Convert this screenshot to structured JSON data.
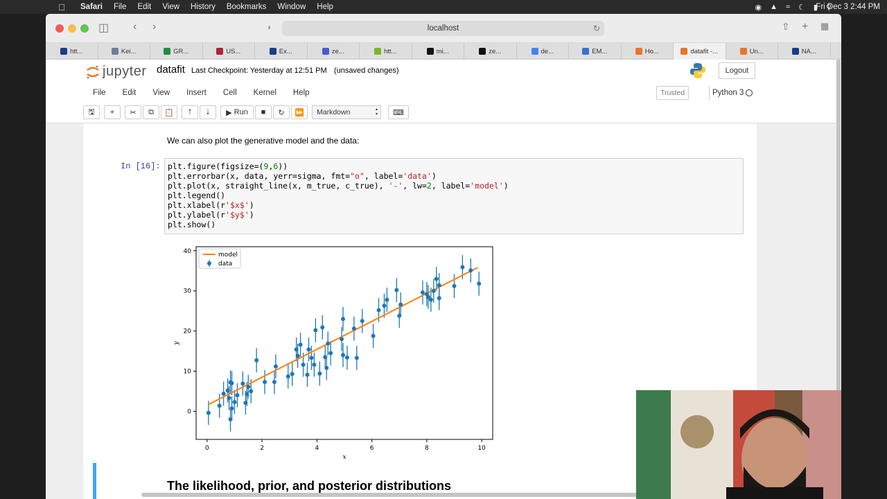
{
  "macos_menubar": {
    "app": "Safari",
    "items": [
      "File",
      "Edit",
      "View",
      "History",
      "Bookmarks",
      "Window",
      "Help"
    ],
    "clock": "Fri Dec 3  2:44 PM"
  },
  "browser": {
    "url": "localhost",
    "tabs": [
      {
        "label": "htt...",
        "color": "#1a3d8a"
      },
      {
        "label": "Kei...",
        "color": "#6b7f99"
      },
      {
        "label": "GR...",
        "color": "#1e8e3e"
      },
      {
        "label": "US...",
        "color": "#b22234"
      },
      {
        "label": "Ex...",
        "color": "#1a3d8a"
      },
      {
        "label": "ze...",
        "color": "#4a5bd1"
      },
      {
        "label": "htt...",
        "color": "#7ab82a"
      },
      {
        "label": "mi...",
        "color": "#111111"
      },
      {
        "label": "ze...",
        "color": "#111111"
      },
      {
        "label": "de...",
        "color": "#4285f4"
      },
      {
        "label": "EM...",
        "color": "#3b6fd1"
      },
      {
        "label": "Ho...",
        "color": "#e8742c"
      },
      {
        "label": "datafit -...",
        "color": "#e8742c"
      },
      {
        "label": "Un...",
        "color": "#e8742c"
      },
      {
        "label": "NA...",
        "color": "#1a3d8a"
      }
    ],
    "active_tab_index": 12
  },
  "jupyter": {
    "logo_text": "jupyter",
    "notebook_name": "datafit",
    "checkpoint": "Last Checkpoint: Yesterday at 12:51 PM",
    "unsaved": "(unsaved changes)",
    "logout": "Logout",
    "menus": [
      "File",
      "Edit",
      "View",
      "Insert",
      "Cell",
      "Kernel",
      "Help"
    ],
    "trusted": "Trusted",
    "kernel": "Python 3",
    "run_label": "Run",
    "cell_type": "Markdown",
    "markdown_text": "We can also plot the generative model and the data:",
    "prompt": "In [16]:",
    "heading": "The likelihood, prior, and posterior distributions"
  },
  "chart_data": {
    "type": "scatter",
    "title": "",
    "xlabel": "x",
    "ylabel": "y",
    "xlim": [
      -0.4,
      10.4
    ],
    "ylim": [
      -7,
      41
    ],
    "xticks": [
      0,
      2,
      4,
      6,
      8,
      10
    ],
    "yticks": [
      0,
      10,
      20,
      30,
      40
    ],
    "legend_position": "top-left",
    "series": [
      {
        "name": "model",
        "kind": "line",
        "color": "#ff7f0e",
        "x": [
          0.05,
          9.85
        ],
        "y": [
          1.7,
          35.8
        ]
      },
      {
        "name": "data",
        "kind": "errorbar",
        "color": "#1f77b4",
        "yerr": 3,
        "points": [
          [
            0.05,
            -0.4
          ],
          [
            0.45,
            1.4
          ],
          [
            0.6,
            4.4
          ],
          [
            0.75,
            5.2
          ],
          [
            0.8,
            3.3
          ],
          [
            0.85,
            7.2
          ],
          [
            0.85,
            -2.0
          ],
          [
            0.9,
            0.7
          ],
          [
            0.9,
            7.0
          ],
          [
            1.0,
            2.3
          ],
          [
            1.1,
            4.0
          ],
          [
            1.3,
            6.9
          ],
          [
            1.4,
            2.1
          ],
          [
            1.45,
            4.3
          ],
          [
            1.5,
            6.1
          ],
          [
            1.6,
            5.0
          ],
          [
            1.8,
            12.7
          ],
          [
            2.1,
            7.3
          ],
          [
            2.45,
            7.3
          ],
          [
            2.5,
            11.2
          ],
          [
            2.95,
            8.7
          ],
          [
            3.1,
            9.3
          ],
          [
            3.25,
            15.4
          ],
          [
            3.3,
            13.8
          ],
          [
            3.4,
            16.6
          ],
          [
            3.5,
            11.6
          ],
          [
            3.65,
            9.1
          ],
          [
            3.7,
            15.4
          ],
          [
            3.8,
            13.3
          ],
          [
            3.9,
            11.6
          ],
          [
            3.95,
            20.2
          ],
          [
            4.1,
            9.4
          ],
          [
            4.2,
            20.9
          ],
          [
            4.3,
            13.5
          ],
          [
            4.35,
            10.8
          ],
          [
            4.4,
            16.9
          ],
          [
            4.5,
            14.5
          ],
          [
            4.9,
            18.0
          ],
          [
            4.95,
            23.0
          ],
          [
            4.95,
            14.0
          ],
          [
            5.1,
            13.4
          ],
          [
            5.35,
            20.6
          ],
          [
            5.45,
            13.3
          ],
          [
            5.65,
            22.5
          ],
          [
            6.05,
            18.8
          ],
          [
            6.25,
            25.2
          ],
          [
            6.45,
            26.3
          ],
          [
            6.55,
            27.8
          ],
          [
            6.9,
            30.2
          ],
          [
            7.0,
            23.8
          ],
          [
            7.05,
            26.6
          ],
          [
            7.85,
            29.6
          ],
          [
            8.0,
            29.2
          ],
          [
            8.05,
            28.5
          ],
          [
            8.15,
            27.8
          ],
          [
            8.25,
            30.0
          ],
          [
            8.35,
            33.0
          ],
          [
            8.45,
            31.4
          ],
          [
            8.45,
            28.2
          ],
          [
            9.0,
            31.2
          ],
          [
            9.3,
            35.9
          ],
          [
            9.6,
            35.1
          ],
          [
            9.9,
            31.8
          ]
        ]
      }
    ]
  },
  "code_lines": [
    [
      [
        "plt.figure(figsize=(",
        ""
      ],
      [
        "9",
        "num"
      ],
      [
        ",",
        ""
      ],
      [
        "6",
        "num"
      ],
      [
        "))",
        ""
      ]
    ],
    [
      [
        "plt.errorbar(x, data, yerr=sigma, fmt=",
        ""
      ],
      [
        "\"o\"",
        "str"
      ],
      [
        ", label=",
        ""
      ],
      [
        "'data'",
        "str"
      ],
      [
        ")",
        ""
      ]
    ],
    [
      [
        "plt.plot(x, straight_line(x, m_true, c_true), ",
        ""
      ],
      [
        "'-'",
        "str"
      ],
      [
        ", lw=",
        ""
      ],
      [
        "2",
        "num"
      ],
      [
        ", label=",
        ""
      ],
      [
        "'model'",
        "str"
      ],
      [
        ")",
        ""
      ]
    ],
    [
      [
        "plt.legend()",
        ""
      ]
    ],
    [
      [
        "plt.xlabel(r",
        ""
      ],
      [
        "'$x$'",
        "str"
      ],
      [
        ")",
        ""
      ]
    ],
    [
      [
        "plt.ylabel(r",
        ""
      ],
      [
        "'$y$'",
        "str"
      ],
      [
        ")",
        ""
      ]
    ],
    [
      [
        "plt.show()",
        ""
      ]
    ]
  ]
}
